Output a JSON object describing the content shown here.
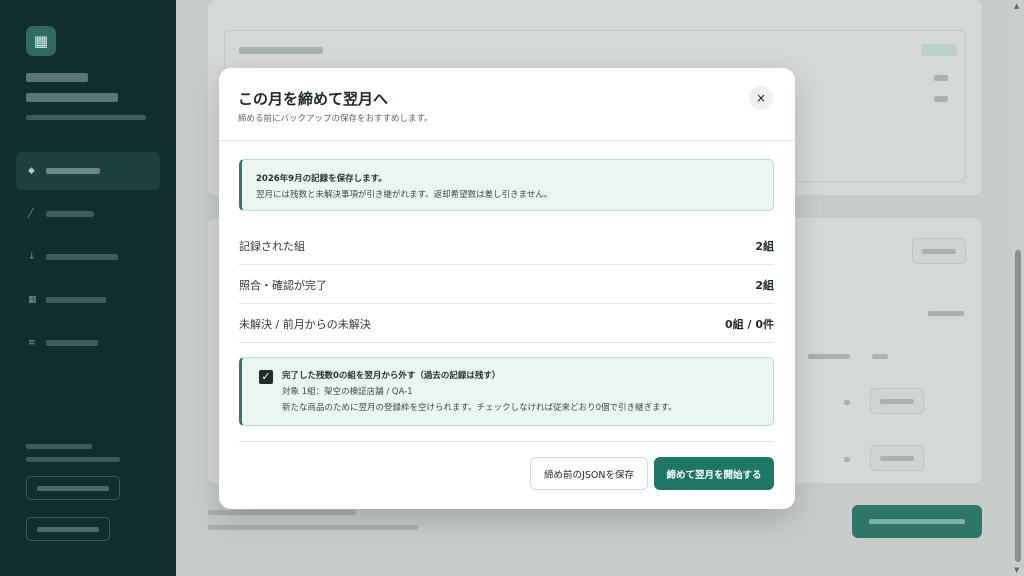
{
  "modal": {
    "title": "この月を締めて翌月へ",
    "subtitle": "締める前にバックアップの保存をおすすめします。",
    "close": "×",
    "info": {
      "title": "2026年9月の記録を保存します。",
      "description": "翌月には残数と未解決事項が引き継がれます。返却希望数は差し引きません。"
    },
    "stats": [
      {
        "label": "記録された組",
        "value": "2組"
      },
      {
        "label": "照合・確認が完了",
        "value": "2組"
      },
      {
        "label": "未解決 / 前月からの未解決",
        "value": "0組 / 0件"
      }
    ],
    "option": {
      "checked": true,
      "title": "完了した残数0の組を翌月から外す（過去の記録は残す）",
      "target": "対象 1組：架空の検証店舗 / QA-1",
      "description": "新たな商品のために翌月の登録枠を空けられます。チェックしなければ従来どおり0個で引き継ぎます。"
    },
    "buttons": {
      "save_json": "締め前のJSONを保存",
      "close_and_start": "締めて翌月を開始する"
    }
  },
  "colors": {
    "accent": "#1f7566",
    "sidebar": "#0f2e2c",
    "info_bg": "#ebf5f1"
  }
}
